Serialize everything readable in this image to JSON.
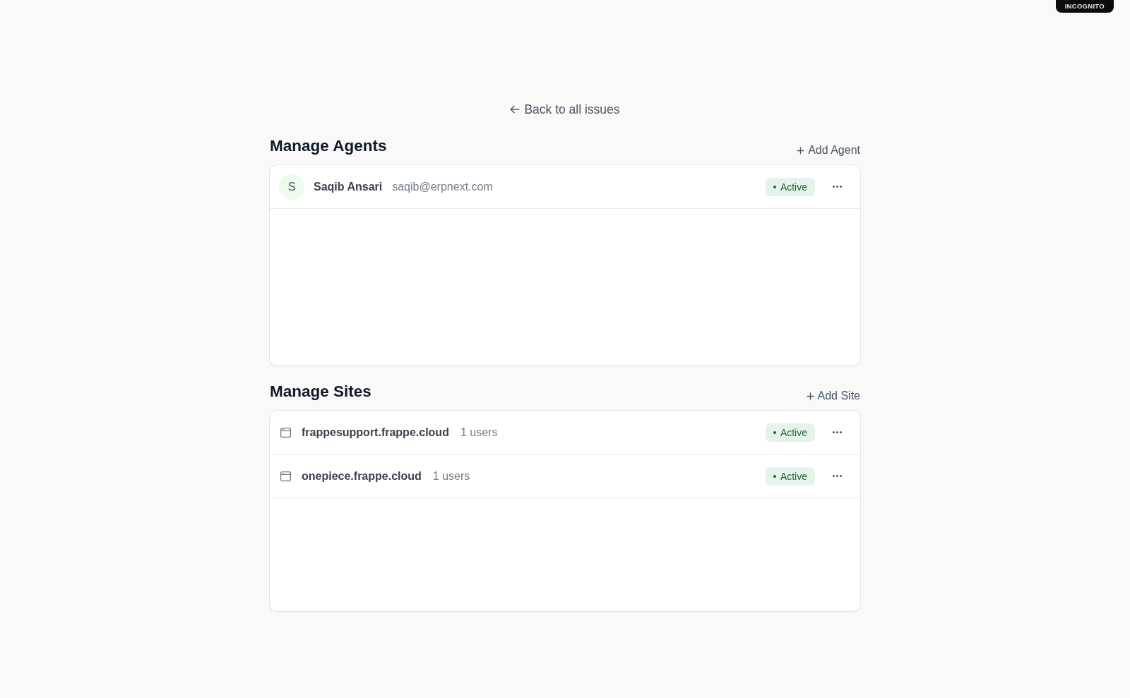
{
  "browser": {
    "incognito_badge": "INCOGNITO"
  },
  "back_link": {
    "label": "Back to all issues"
  },
  "agents": {
    "title": "Manage Agents",
    "add_label": "Add Agent",
    "rows": [
      {
        "initial": "S",
        "name": "Saqib Ansari",
        "email": "saqib@erpnext.com",
        "status": "Active"
      }
    ]
  },
  "sites": {
    "title": "Manage Sites",
    "add_label": "Add Site",
    "rows": [
      {
        "name": "frappesupport.frappe.cloud",
        "users": "1 users",
        "status": "Active"
      },
      {
        "name": "onepiece.frappe.cloud",
        "users": "1 users",
        "status": "Active"
      }
    ]
  }
}
